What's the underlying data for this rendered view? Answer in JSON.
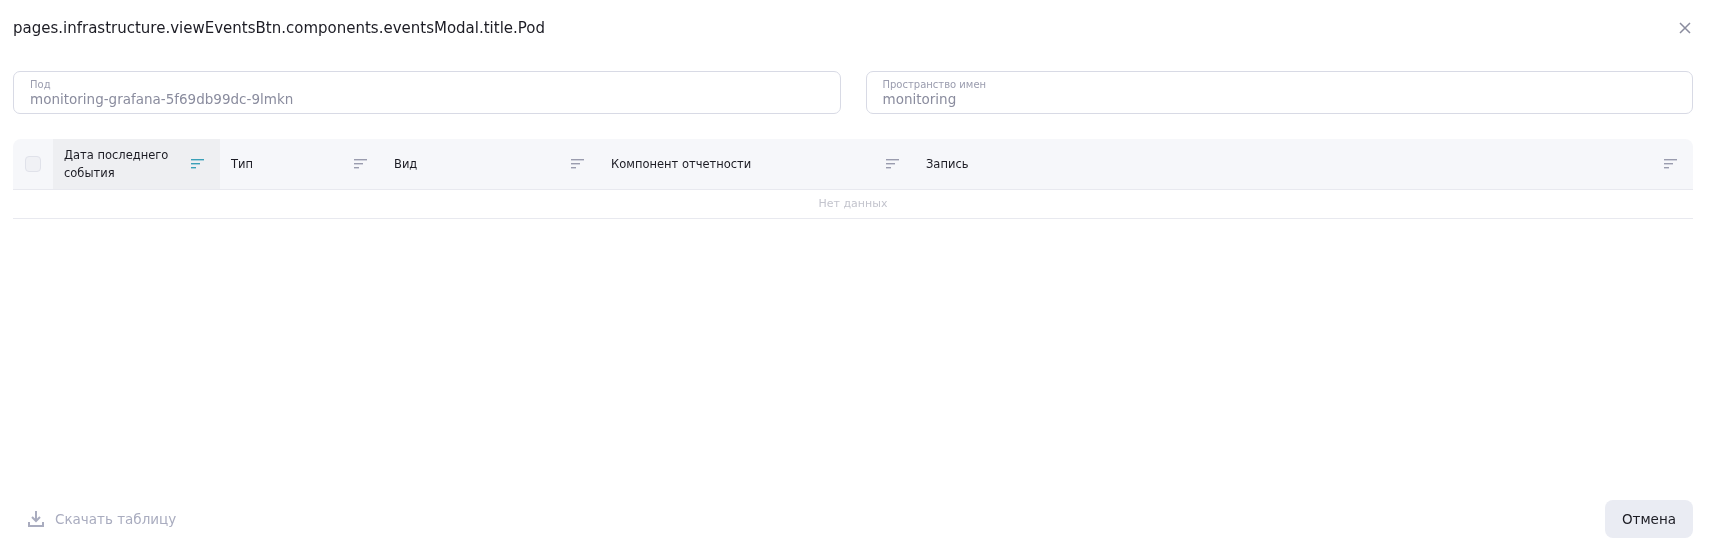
{
  "dialog": {
    "title": "pages.infrastructure.viewEventsBtn.components.eventsModal.title.Pod"
  },
  "fields": [
    {
      "label": "Под",
      "value": "monitoring-grafana-5f69db99dc-9lmkn"
    },
    {
      "label": "Пространство имен",
      "value": "monitoring"
    }
  ],
  "table": {
    "select_all": {
      "checked": false
    },
    "columns": [
      {
        "label": "Дата последнего события",
        "sorted": true
      },
      {
        "label": "Тип",
        "sorted": false
      },
      {
        "label": "Вид",
        "sorted": false
      },
      {
        "label": "Компонент отчетности",
        "sorted": false
      },
      {
        "label": "Запись",
        "sorted": false
      }
    ],
    "empty_text": "Нет данных"
  },
  "footer": {
    "download": {
      "label": "Скачать таблицу",
      "disabled": true
    },
    "cancel": "Отмена"
  }
}
